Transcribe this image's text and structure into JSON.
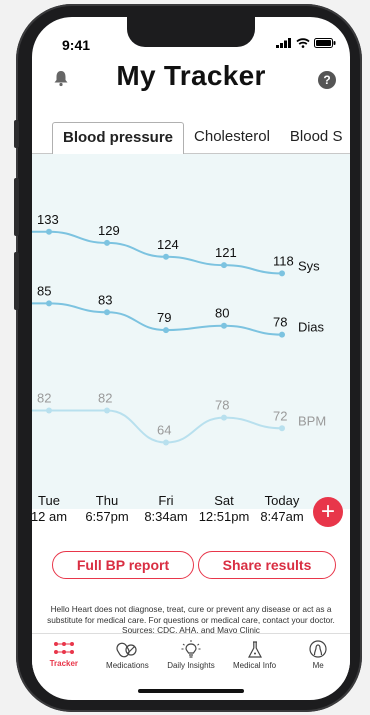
{
  "status": {
    "time": "9:41"
  },
  "header": {
    "title": "My Tracker",
    "help_label": "?"
  },
  "tabs": [
    {
      "label": "Blood pressure",
      "active": true
    },
    {
      "label": "Cholesterol",
      "active": false
    },
    {
      "label": "Blood S",
      "active": false
    }
  ],
  "chart_data": {
    "type": "line",
    "categories": [
      "Tue 12 am",
      "Thu 6:57pm",
      "Fri 8:34am",
      "Sat 12:51pm",
      "Today 8:47am"
    ],
    "x_labels": [
      {
        "day": "Tue",
        "time": "12 am"
      },
      {
        "day": "Thu",
        "time": "6:57pm"
      },
      {
        "day": "Fri",
        "time": "8:34am"
      },
      {
        "day": "Sat",
        "time": "12:51pm"
      },
      {
        "day": "Today",
        "time": "8:47am"
      }
    ],
    "series": [
      {
        "name": "Sys",
        "values": [
          133,
          129,
          124,
          121,
          118
        ],
        "color": "#7cc3e0"
      },
      {
        "name": "Dias",
        "values": [
          85,
          83,
          79,
          80,
          78
        ],
        "color": "#7cc3e0"
      },
      {
        "name": "BPM",
        "values": [
          82,
          82,
          64,
          78,
          72
        ],
        "color": "#b8e0ee"
      }
    ]
  },
  "actions": {
    "add_label": "+",
    "full_report_label": "Full BP report",
    "share_label": "Share results"
  },
  "disclaimer": {
    "text": "Hello Heart does not diagnose, treat, cure or prevent any disease or act as a substitute for medical care. For questions or medical care, contact your doctor. Sources: ",
    "source_cdc": "CDC",
    "sep1": ", ",
    "source_aha": "AHA",
    "sep2": ", and ",
    "source_mayo": "Mayo Clinic"
  },
  "tabbar": [
    {
      "label": "Tracker",
      "icon": "tracker-icon",
      "active": true
    },
    {
      "label": "Medications",
      "icon": "pills-icon",
      "active": false
    },
    {
      "label": "Daily Insights",
      "icon": "lightbulb-icon",
      "active": false
    },
    {
      "label": "Medical Info",
      "icon": "flask-icon",
      "active": false
    },
    {
      "label": "Me",
      "icon": "head-icon",
      "active": false
    }
  ],
  "colors": {
    "accent": "#e8364a",
    "chart_bg": "#eef7f8",
    "line": "#7cc3e0",
    "line_light": "#b8e0ee"
  }
}
